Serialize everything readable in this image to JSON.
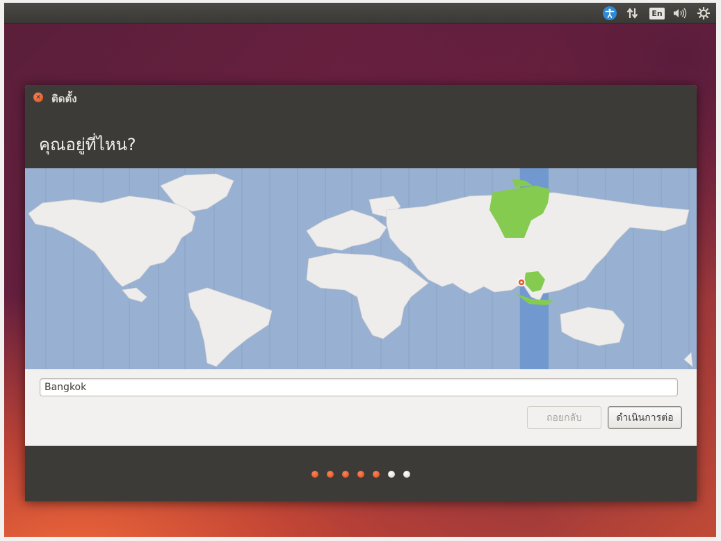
{
  "topbar": {
    "icons": [
      "accessibility-icon",
      "network-icon",
      "keyboard-layout-icon",
      "volume-icon",
      "gear-icon"
    ],
    "keyboard_label": "En"
  },
  "window": {
    "title": "ติดตั้ง",
    "heading": "คุณอยู่ที่ไหน?"
  },
  "timezone": {
    "value": "Bangkok",
    "selected_location": "Bangkok"
  },
  "buttons": {
    "back": "ถอยกลับ",
    "continue": "ดำเนินการต่อ"
  },
  "progress": {
    "total_steps": 7,
    "completed_steps": 5
  },
  "colors": {
    "accent": "#dd4814",
    "map_ocean": "#98b1d2",
    "map_land": "#efedec",
    "map_highlight_zone": "#84cb50",
    "map_timezone_band": "#7199cf"
  }
}
